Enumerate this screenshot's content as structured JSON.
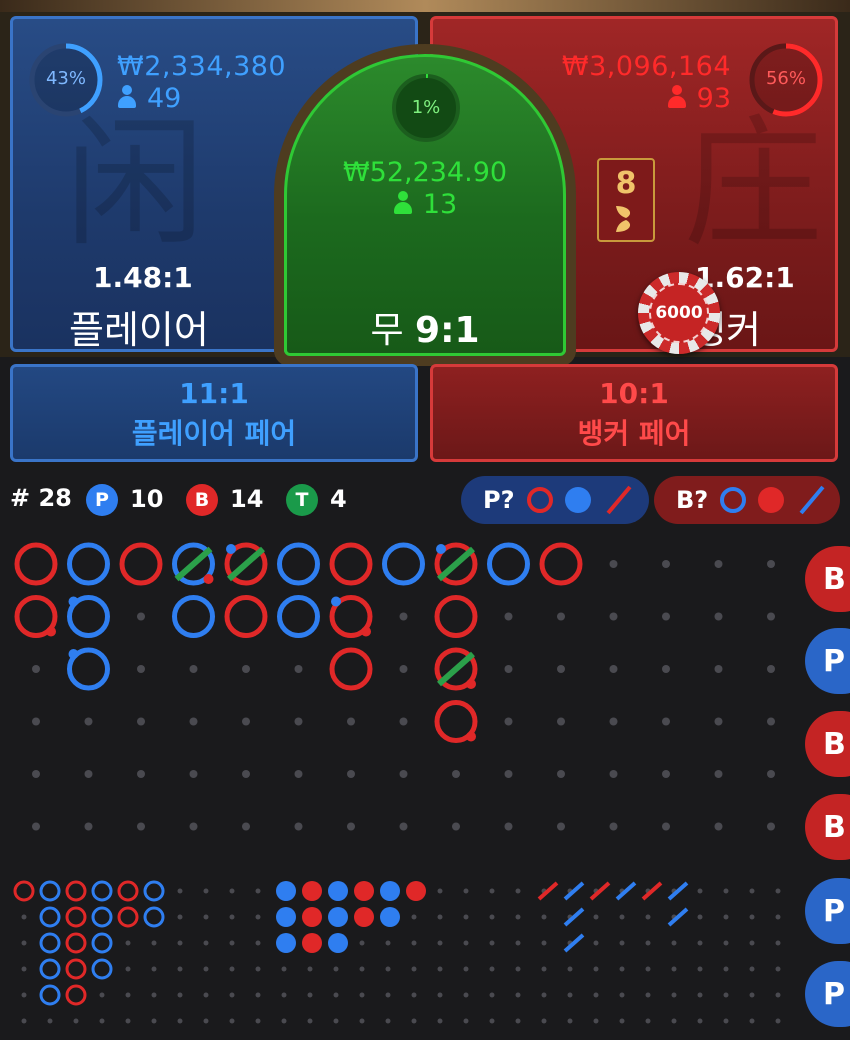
{
  "player": {
    "percent_label": "43%",
    "percent": 43,
    "money": "₩2,334,380",
    "players": "49",
    "odds": "1.48:1",
    "name": "플레이어",
    "hanzi": "闲",
    "color": "#3fa0ff"
  },
  "banker": {
    "percent_label": "56%",
    "percent": 56,
    "money": "₩3,096,164",
    "players": "93",
    "odds": "1.62:1",
    "name": "뱅커",
    "hanzi": "庄",
    "color": "#ff2a2a"
  },
  "tie": {
    "percent_label": "1%",
    "percent": 1,
    "money": "₩52,234.90",
    "players": "13",
    "name": "무",
    "odds": "9:1",
    "color": "#2fe03a"
  },
  "card": {
    "value": "8"
  },
  "chip": {
    "value": "6000"
  },
  "pairs": {
    "player": {
      "odds": "11:1",
      "name": "플레이어 페어"
    },
    "banker": {
      "odds": "10:1",
      "name": "뱅커 페어"
    }
  },
  "stats": {
    "total_label": "# 28",
    "player_badge": "P",
    "player_count": "10",
    "banker_badge": "B",
    "banker_count": "14",
    "tie_badge": "T",
    "tie_count": "4"
  },
  "ask": {
    "player_label": "P?",
    "banker_label": "B?"
  },
  "side_buttons": [
    "B",
    "P",
    "B",
    "B",
    "P",
    "P"
  ],
  "colors": {
    "player": "#2f7ef0",
    "banker": "#e02828",
    "tie": "#1a9a4a",
    "dot": "#4a4a50"
  },
  "roadmap": {
    "big_road": [
      {
        "result": "B",
        "col": 0,
        "row": 0
      },
      {
        "result": "B",
        "col": 0,
        "row": 1,
        "banker_pair": true
      },
      {
        "result": "P",
        "col": 1,
        "row": 0
      },
      {
        "result": "P",
        "col": 1,
        "row": 1,
        "player_pair": true
      },
      {
        "result": "P",
        "col": 1,
        "row": 2,
        "player_pair": true
      },
      {
        "result": "B",
        "col": 2,
        "row": 0
      },
      {
        "result": "P",
        "col": 3,
        "row": 0,
        "tie": true,
        "banker_pair": true
      },
      {
        "result": "P",
        "col": 3,
        "row": 1
      },
      {
        "result": "B",
        "col": 4,
        "row": 0,
        "tie": true,
        "player_pair": true
      },
      {
        "result": "B",
        "col": 4,
        "row": 1
      },
      {
        "result": "P",
        "col": 5,
        "row": 0
      },
      {
        "result": "P",
        "col": 5,
        "row": 1
      },
      {
        "result": "B",
        "col": 6,
        "row": 0
      },
      {
        "result": "B",
        "col": 6,
        "row": 1,
        "player_pair": true,
        "banker_pair": true
      },
      {
        "result": "B",
        "col": 6,
        "row": 2
      },
      {
        "result": "P",
        "col": 7,
        "row": 0
      },
      {
        "result": "B",
        "col": 8,
        "row": 0,
        "tie": true,
        "player_pair": true
      },
      {
        "result": "B",
        "col": 8,
        "row": 1
      },
      {
        "result": "B",
        "col": 8,
        "row": 2,
        "tie": true,
        "banker_pair": true
      },
      {
        "result": "B",
        "col": 8,
        "row": 3,
        "banker_pair": true
      },
      {
        "result": "P",
        "col": 9,
        "row": 0
      },
      {
        "result": "B",
        "col": 10,
        "row": 0
      }
    ],
    "big_eye_road": [
      [
        "R",
        "B",
        "R",
        "B",
        "R",
        "B"
      ],
      [
        "",
        "B",
        "R",
        "B",
        "R",
        "B"
      ],
      [
        "",
        "B",
        "R",
        "B",
        "",
        ""
      ],
      [
        "",
        "B",
        "R",
        "B",
        "",
        ""
      ],
      [
        "",
        "B",
        "R",
        "",
        "",
        ""
      ]
    ],
    "small_road": [
      [
        "B",
        "R",
        "B",
        "R",
        "B",
        "R"
      ],
      [
        "B",
        "R",
        "B",
        "R",
        "B",
        ""
      ],
      [
        "B",
        "R",
        "B",
        "",
        "",
        ""
      ]
    ],
    "cockroach_road": [
      [
        "R",
        "B",
        "R",
        "B",
        "R",
        "B"
      ],
      [
        "",
        "B",
        "",
        "",
        "",
        "B"
      ],
      [
        "",
        "B",
        "",
        "",
        "",
        ""
      ]
    ]
  }
}
